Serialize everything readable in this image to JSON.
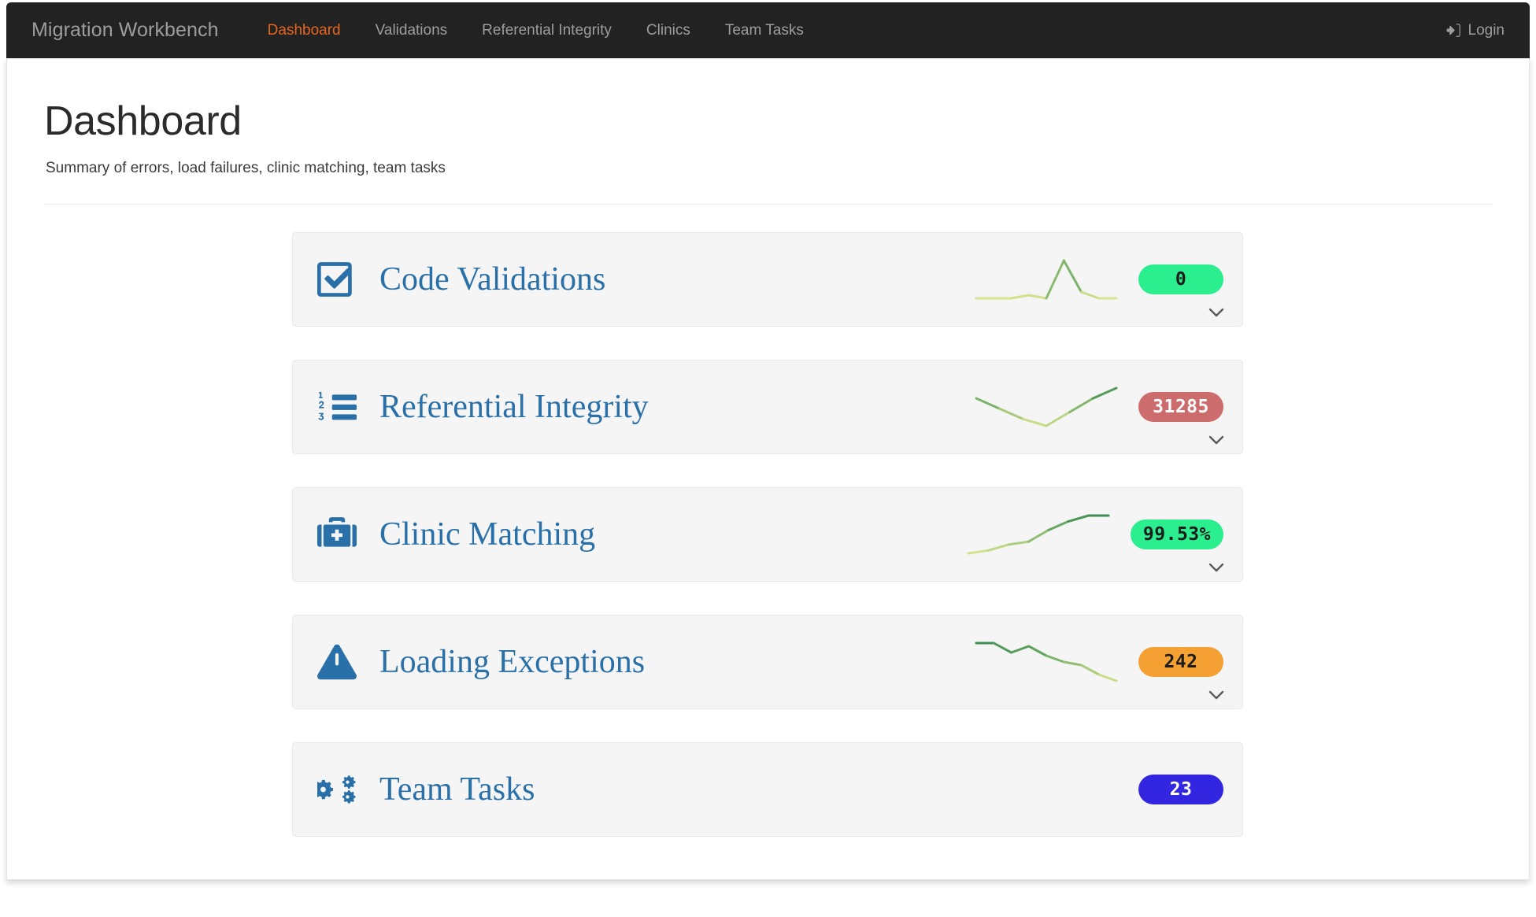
{
  "navbar": {
    "brand": "Migration Workbench",
    "links": [
      {
        "label": "Dashboard",
        "active": true
      },
      {
        "label": "Validations",
        "active": false
      },
      {
        "label": "Referential Integrity",
        "active": false
      },
      {
        "label": "Clinics",
        "active": false
      },
      {
        "label": "Team Tasks",
        "active": false
      }
    ],
    "login_label": "Login",
    "login_icon": "sign-in-icon",
    "background_color": "#222222",
    "link_color": "#9d9d9d",
    "active_link_color": "#e8651d"
  },
  "header": {
    "title": "Dashboard",
    "subtitle": "Summary of errors, load failures, clinic matching, team tasks"
  },
  "cards": [
    {
      "title": "Code Validations",
      "icon": "check-square-icon",
      "badge_value": "0",
      "badge_bg": "#2bee8e",
      "badge_fg": "#1c1c1c",
      "has_sparkline": true,
      "has_chevron": true,
      "sparkline_points": [
        2,
        2,
        2,
        3,
        2,
        14,
        4,
        2,
        2
      ]
    },
    {
      "title": "Referential Integrity",
      "icon": "ordered-list-icon",
      "badge_value": "31285",
      "badge_bg": "#cd6c6c",
      "badge_fg": "#ffffff",
      "has_sparkline": true,
      "has_chevron": true,
      "sparkline_points": [
        9,
        6,
        3,
        1,
        5,
        9,
        12
      ]
    },
    {
      "title": "Clinic Matching",
      "icon": "medical-kit-icon",
      "badge_value": "99.53%",
      "badge_bg": "#2bee8e",
      "badge_fg": "#1c1c1c",
      "has_sparkline": true,
      "has_chevron": true,
      "sparkline_points": [
        1,
        2,
        4,
        5,
        9,
        12,
        14,
        14
      ]
    },
    {
      "title": "Loading Exceptions",
      "icon": "warning-triangle-icon",
      "badge_value": "242",
      "badge_bg": "#f4a033",
      "badge_fg": "#1c1c1c",
      "has_sparkline": true,
      "has_chevron": true,
      "sparkline_points": [
        13,
        13,
        10,
        12,
        9,
        7,
        6,
        3,
        1
      ]
    },
    {
      "title": "Team Tasks",
      "icon": "cogs-icon",
      "badge_value": "23",
      "badge_bg": "#3326e0",
      "badge_fg": "#ffffff",
      "has_sparkline": false,
      "has_chevron": false,
      "sparkline_points": []
    }
  ],
  "theme": {
    "card_bg": "#f5f5f5",
    "card_border": "#e7e7e7",
    "title_color": "#2a70a8",
    "sparkline_low": "#d7e58f",
    "sparkline_high": "#3f8f52"
  }
}
